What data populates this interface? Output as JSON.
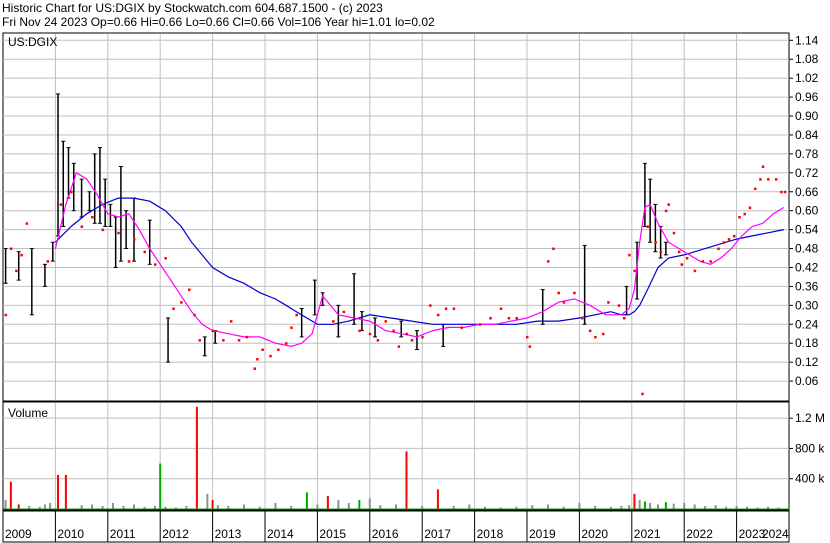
{
  "header": {
    "line1": "Historic Chart for US:DGIX by Stockwatch.com 604.687.1500 - (c) 2023",
    "line2": "Fri Nov 24 2023  Op=0.66  Hi=0.66  Lo=0.66  Cl=0.66  Vol=106  Year hi=1.01  lo=0.02"
  },
  "colors": {
    "grid": "#c0c0c0",
    "candle": "#000000",
    "dots": "#ff0000",
    "ma_short": "#ff00ff",
    "ma_long": "#0000cc",
    "vol_gray": "#909090",
    "vol_green": "#00aa00",
    "vol_red": "#ff0000"
  },
  "chart_data": [
    {
      "type": "line",
      "title": "US:DGIX",
      "ylim": [
        0.0,
        1.16
      ],
      "yticks": [
        "1.14",
        "1.08",
        "1.02",
        "0.96",
        "0.90",
        "0.84",
        "0.78",
        "0.72",
        "0.66",
        "0.60",
        "0.54",
        "0.48",
        "0.42",
        "0.36",
        "0.30",
        "0.24",
        "0.18",
        "0.12",
        "0.06"
      ],
      "xlim": [
        2009.0,
        2024.0
      ],
      "xticks": [
        "2009",
        "2010",
        "2011",
        "2012",
        "2013",
        "2014",
        "2015",
        "2016",
        "2017",
        "2018",
        "2019",
        "2020",
        "2021",
        "2022",
        "2023",
        "2024"
      ],
      "series": [
        {
          "key": "ma_long",
          "x": [
            2010.0,
            2010.3,
            2010.6,
            2010.9,
            2011.2,
            2011.5,
            2011.8,
            2012.1,
            2012.4,
            2012.6,
            2012.8,
            2013.0,
            2013.3,
            2013.6,
            2013.9,
            2014.2,
            2014.4,
            2014.6,
            2014.8,
            2015.0,
            2015.3,
            2015.6,
            2016.0,
            2016.4,
            2016.8,
            2017.2,
            2017.6,
            2018.0,
            2018.4,
            2018.8,
            2019.2,
            2019.6,
            2020.0,
            2020.3,
            2020.6,
            2020.8,
            2020.95,
            2021.05,
            2021.15,
            2021.3,
            2021.5,
            2021.7,
            2022.0,
            2022.4,
            2022.8,
            2023.0,
            2023.3,
            2023.6,
            2023.9
          ],
          "y": [
            0.5,
            0.55,
            0.59,
            0.62,
            0.64,
            0.64,
            0.63,
            0.6,
            0.55,
            0.5,
            0.46,
            0.42,
            0.39,
            0.37,
            0.34,
            0.32,
            0.3,
            0.28,
            0.26,
            0.24,
            0.24,
            0.25,
            0.27,
            0.26,
            0.25,
            0.24,
            0.24,
            0.24,
            0.24,
            0.24,
            0.25,
            0.25,
            0.26,
            0.27,
            0.28,
            0.27,
            0.27,
            0.28,
            0.3,
            0.35,
            0.42,
            0.45,
            0.46,
            0.48,
            0.5,
            0.51,
            0.52,
            0.53,
            0.54
          ]
        },
        {
          "key": "ma_short",
          "x": [
            2010.0,
            2010.2,
            2010.4,
            2010.6,
            2010.8,
            2011.0,
            2011.2,
            2011.4,
            2011.6,
            2011.8,
            2012.0,
            2012.2,
            2012.4,
            2012.6,
            2012.8,
            2013.0,
            2013.3,
            2013.6,
            2013.9,
            2014.2,
            2014.5,
            2014.7,
            2014.9,
            2015.1,
            2015.4,
            2015.7,
            2016.0,
            2016.3,
            2016.6,
            2016.9,
            2017.2,
            2017.5,
            2017.8,
            2018.1,
            2018.4,
            2018.7,
            2019.0,
            2019.3,
            2019.6,
            2019.9,
            2020.2,
            2020.5,
            2020.8,
            2020.95,
            2021.05,
            2021.15,
            2021.25,
            2021.35,
            2021.5,
            2021.7,
            2021.9,
            2022.1,
            2022.3,
            2022.5,
            2022.7,
            2022.9,
            2023.1,
            2023.3,
            2023.5,
            2023.7,
            2023.9
          ],
          "y": [
            0.48,
            0.62,
            0.72,
            0.7,
            0.65,
            0.59,
            0.58,
            0.59,
            0.54,
            0.48,
            0.43,
            0.38,
            0.33,
            0.28,
            0.24,
            0.22,
            0.21,
            0.2,
            0.2,
            0.18,
            0.17,
            0.18,
            0.21,
            0.33,
            0.27,
            0.26,
            0.25,
            0.22,
            0.21,
            0.2,
            0.22,
            0.23,
            0.23,
            0.24,
            0.24,
            0.25,
            0.26,
            0.28,
            0.31,
            0.32,
            0.3,
            0.27,
            0.27,
            0.29,
            0.35,
            0.5,
            0.61,
            0.62,
            0.56,
            0.5,
            0.48,
            0.46,
            0.44,
            0.43,
            0.45,
            0.48,
            0.52,
            0.55,
            0.56,
            0.59,
            0.61
          ]
        }
      ],
      "price_points": [
        {
          "x": 2009.05,
          "y": 0.27
        },
        {
          "x": 2009.15,
          "y": 0.48
        },
        {
          "x": 2009.25,
          "y": 0.41
        },
        {
          "x": 2009.35,
          "y": 0.46
        },
        {
          "x": 2009.45,
          "y": 0.56
        },
        {
          "x": 2009.85,
          "y": 0.44
        },
        {
          "x": 2010.1,
          "y": 0.62
        },
        {
          "x": 2010.3,
          "y": 0.66
        },
        {
          "x": 2010.5,
          "y": 0.55
        },
        {
          "x": 2010.7,
          "y": 0.58
        },
        {
          "x": 2010.9,
          "y": 0.54
        },
        {
          "x": 2011.2,
          "y": 0.53
        },
        {
          "x": 2011.4,
          "y": 0.44
        },
        {
          "x": 2011.5,
          "y": 0.51
        },
        {
          "x": 2011.7,
          "y": 0.47
        },
        {
          "x": 2011.9,
          "y": 0.43
        },
        {
          "x": 2012.1,
          "y": 0.45
        },
        {
          "x": 2012.25,
          "y": 0.29
        },
        {
          "x": 2012.4,
          "y": 0.31
        },
        {
          "x": 2012.55,
          "y": 0.35
        },
        {
          "x": 2012.65,
          "y": 0.27
        },
        {
          "x": 2012.75,
          "y": 0.19
        },
        {
          "x": 2013.0,
          "y": 0.22
        },
        {
          "x": 2013.2,
          "y": 0.19
        },
        {
          "x": 2013.35,
          "y": 0.25
        },
        {
          "x": 2013.5,
          "y": 0.19
        },
        {
          "x": 2013.65,
          "y": 0.2
        },
        {
          "x": 2013.8,
          "y": 0.1
        },
        {
          "x": 2013.85,
          "y": 0.13
        },
        {
          "x": 2013.95,
          "y": 0.16
        },
        {
          "x": 2014.1,
          "y": 0.14
        },
        {
          "x": 2014.25,
          "y": 0.16
        },
        {
          "x": 2014.4,
          "y": 0.18
        },
        {
          "x": 2014.5,
          "y": 0.23
        },
        {
          "x": 2014.6,
          "y": 0.27
        },
        {
          "x": 2015.3,
          "y": 0.25
        },
        {
          "x": 2015.5,
          "y": 0.28
        },
        {
          "x": 2015.8,
          "y": 0.22
        },
        {
          "x": 2016.0,
          "y": 0.21
        },
        {
          "x": 2016.15,
          "y": 0.19
        },
        {
          "x": 2016.3,
          "y": 0.25
        },
        {
          "x": 2016.45,
          "y": 0.22
        },
        {
          "x": 2016.55,
          "y": 0.17
        },
        {
          "x": 2016.7,
          "y": 0.21
        },
        {
          "x": 2016.8,
          "y": 0.19
        },
        {
          "x": 2017.0,
          "y": 0.2
        },
        {
          "x": 2017.15,
          "y": 0.3
        },
        {
          "x": 2017.3,
          "y": 0.27
        },
        {
          "x": 2017.45,
          "y": 0.29
        },
        {
          "x": 2017.6,
          "y": 0.29
        },
        {
          "x": 2017.75,
          "y": 0.23
        },
        {
          "x": 2018.1,
          "y": 0.24
        },
        {
          "x": 2018.3,
          "y": 0.26
        },
        {
          "x": 2018.5,
          "y": 0.29
        },
        {
          "x": 2018.65,
          "y": 0.26
        },
        {
          "x": 2018.8,
          "y": 0.26
        },
        {
          "x": 2019.0,
          "y": 0.2
        },
        {
          "x": 2019.05,
          "y": 0.17
        },
        {
          "x": 2019.4,
          "y": 0.44
        },
        {
          "x": 2019.5,
          "y": 0.48
        },
        {
          "x": 2019.6,
          "y": 0.34
        },
        {
          "x": 2019.7,
          "y": 0.31
        },
        {
          "x": 2019.9,
          "y": 0.34
        },
        {
          "x": 2020.05,
          "y": 0.26
        },
        {
          "x": 2020.2,
          "y": 0.22
        },
        {
          "x": 2020.3,
          "y": 0.2
        },
        {
          "x": 2020.45,
          "y": 0.21
        },
        {
          "x": 2020.55,
          "y": 0.31
        },
        {
          "x": 2020.75,
          "y": 0.3
        },
        {
          "x": 2020.85,
          "y": 0.26
        },
        {
          "x": 2020.95,
          "y": 0.46
        },
        {
          "x": 2021.05,
          "y": 0.41
        },
        {
          "x": 2021.2,
          "y": 0.02
        },
        {
          "x": 2021.3,
          "y": 0.55
        },
        {
          "x": 2021.45,
          "y": 0.5
        },
        {
          "x": 2021.55,
          "y": 0.47
        },
        {
          "x": 2021.65,
          "y": 0.6
        },
        {
          "x": 2021.7,
          "y": 0.62
        },
        {
          "x": 2021.8,
          "y": 0.53
        },
        {
          "x": 2021.9,
          "y": 0.47
        },
        {
          "x": 2021.95,
          "y": 0.43
        },
        {
          "x": 2022.05,
          "y": 0.45
        },
        {
          "x": 2022.2,
          "y": 0.41
        },
        {
          "x": 2022.35,
          "y": 0.44
        },
        {
          "x": 2022.5,
          "y": 0.44
        },
        {
          "x": 2022.65,
          "y": 0.48
        },
        {
          "x": 2022.75,
          "y": 0.5
        },
        {
          "x": 2022.85,
          "y": 0.51
        },
        {
          "x": 2022.95,
          "y": 0.52
        },
        {
          "x": 2023.05,
          "y": 0.58
        },
        {
          "x": 2023.15,
          "y": 0.59
        },
        {
          "x": 2023.25,
          "y": 0.61
        },
        {
          "x": 2023.35,
          "y": 0.67
        },
        {
          "x": 2023.45,
          "y": 0.7
        },
        {
          "x": 2023.5,
          "y": 0.74
        },
        {
          "x": 2023.6,
          "y": 0.7
        },
        {
          "x": 2023.75,
          "y": 0.7
        },
        {
          "x": 2023.85,
          "y": 0.66
        },
        {
          "x": 2023.92,
          "y": 0.66
        }
      ],
      "candles": [
        {
          "x": 2009.05,
          "lo": 0.37,
          "hi": 0.48
        },
        {
          "x": 2009.3,
          "lo": 0.38,
          "hi": 0.47
        },
        {
          "x": 2009.55,
          "lo": 0.27,
          "hi": 0.48
        },
        {
          "x": 2009.8,
          "lo": 0.36,
          "hi": 0.43
        },
        {
          "x": 2009.95,
          "lo": 0.44,
          "hi": 0.5
        },
        {
          "x": 2010.05,
          "lo": 0.52,
          "hi": 0.97
        },
        {
          "x": 2010.15,
          "lo": 0.55,
          "hi": 0.82
        },
        {
          "x": 2010.25,
          "lo": 0.64,
          "hi": 0.8
        },
        {
          "x": 2010.35,
          "lo": 0.6,
          "hi": 0.75
        },
        {
          "x": 2010.5,
          "lo": 0.58,
          "hi": 0.7
        },
        {
          "x": 2010.65,
          "lo": 0.6,
          "hi": 0.66
        },
        {
          "x": 2010.75,
          "lo": 0.56,
          "hi": 0.78
        },
        {
          "x": 2010.85,
          "lo": 0.56,
          "hi": 0.8
        },
        {
          "x": 2010.95,
          "lo": 0.55,
          "hi": 0.7
        },
        {
          "x": 2011.05,
          "lo": 0.55,
          "hi": 0.62
        },
        {
          "x": 2011.15,
          "lo": 0.42,
          "hi": 0.58
        },
        {
          "x": 2011.25,
          "lo": 0.44,
          "hi": 0.74
        },
        {
          "x": 2011.35,
          "lo": 0.48,
          "hi": 0.6
        },
        {
          "x": 2011.5,
          "lo": 0.44,
          "hi": 0.64
        },
        {
          "x": 2011.8,
          "lo": 0.43,
          "hi": 0.57
        },
        {
          "x": 2012.15,
          "lo": 0.12,
          "hi": 0.26
        },
        {
          "x": 2012.85,
          "lo": 0.14,
          "hi": 0.2
        },
        {
          "x": 2013.05,
          "lo": 0.18,
          "hi": 0.22
        },
        {
          "x": 2014.7,
          "lo": 0.2,
          "hi": 0.29
        },
        {
          "x": 2014.95,
          "lo": 0.27,
          "hi": 0.38
        },
        {
          "x": 2015.1,
          "lo": 0.3,
          "hi": 0.34
        },
        {
          "x": 2015.4,
          "lo": 0.2,
          "hi": 0.3
        },
        {
          "x": 2015.7,
          "lo": 0.24,
          "hi": 0.4
        },
        {
          "x": 2015.85,
          "lo": 0.22,
          "hi": 0.28
        },
        {
          "x": 2016.1,
          "lo": 0.2,
          "hi": 0.26
        },
        {
          "x": 2016.6,
          "lo": 0.2,
          "hi": 0.25
        },
        {
          "x": 2016.9,
          "lo": 0.16,
          "hi": 0.22
        },
        {
          "x": 2017.4,
          "lo": 0.17,
          "hi": 0.24
        },
        {
          "x": 2019.3,
          "lo": 0.24,
          "hi": 0.35
        },
        {
          "x": 2020.1,
          "lo": 0.24,
          "hi": 0.49
        },
        {
          "x": 2020.9,
          "lo": 0.27,
          "hi": 0.36
        },
        {
          "x": 2021.1,
          "lo": 0.32,
          "hi": 0.5
        },
        {
          "x": 2021.25,
          "lo": 0.55,
          "hi": 0.75
        },
        {
          "x": 2021.35,
          "lo": 0.5,
          "hi": 0.7
        },
        {
          "x": 2021.45,
          "lo": 0.47,
          "hi": 0.62
        },
        {
          "x": 2021.55,
          "lo": 0.45,
          "hi": 0.55
        },
        {
          "x": 2021.65,
          "lo": 0.46,
          "hi": 0.5
        }
      ]
    },
    {
      "type": "bar",
      "title": "Volume",
      "ylim": [
        0,
        1400000
      ],
      "yticks": [
        {
          "label": "1.2 M",
          "v": 1200000
        },
        {
          "label": "800 k",
          "v": 800000
        },
        {
          "label": "400 k",
          "v": 400000
        }
      ],
      "x": [
        2009.05,
        2009.15,
        2009.3,
        2009.5,
        2009.7,
        2009.8,
        2009.9,
        2010.05,
        2010.2,
        2010.5,
        2010.7,
        2010.9,
        2011.1,
        2011.3,
        2011.5,
        2011.7,
        2011.9,
        2012.0,
        2012.1,
        2012.3,
        2012.5,
        2012.7,
        2012.9,
        2013.0,
        2013.1,
        2013.3,
        2013.6,
        2013.9,
        2014.2,
        2014.5,
        2014.8,
        2015.0,
        2015.2,
        2015.4,
        2015.6,
        2015.8,
        2016.0,
        2016.2,
        2016.5,
        2016.7,
        2017.0,
        2017.3,
        2017.6,
        2017.9,
        2018.2,
        2018.5,
        2018.8,
        2019.1,
        2019.4,
        2019.7,
        2020.0,
        2020.3,
        2020.6,
        2020.8,
        2020.95,
        2021.05,
        2021.15,
        2021.25,
        2021.35,
        2021.5,
        2021.65,
        2021.8,
        2022.0,
        2022.2,
        2022.4,
        2022.6,
        2022.8,
        2023.0,
        2023.2,
        2023.4,
        2023.6,
        2023.8
      ],
      "values": [
        120000,
        360000,
        60000,
        40000,
        30000,
        60000,
        80000,
        450000,
        450000,
        50000,
        60000,
        40000,
        80000,
        40000,
        60000,
        30000,
        40000,
        600000,
        30000,
        20000,
        40000,
        1350000,
        200000,
        120000,
        50000,
        40000,
        60000,
        30000,
        80000,
        40000,
        220000,
        60000,
        170000,
        120000,
        80000,
        120000,
        140000,
        50000,
        60000,
        760000,
        40000,
        260000,
        40000,
        60000,
        30000,
        20000,
        30000,
        50000,
        60000,
        30000,
        80000,
        40000,
        30000,
        40000,
        50000,
        200000,
        120000,
        100000,
        80000,
        60000,
        90000,
        70000,
        80000,
        60000,
        40000,
        50000,
        30000,
        40000,
        30000,
        20000,
        30000,
        20000
      ],
      "colors": [
        "gray",
        "red",
        "red",
        "gray",
        "gray",
        "gray",
        "gray",
        "red",
        "red",
        "gray",
        "gray",
        "gray",
        "gray",
        "gray",
        "gray",
        "gray",
        "gray",
        "green",
        "gray",
        "gray",
        "gray",
        "red",
        "gray",
        "red",
        "gray",
        "gray",
        "gray",
        "gray",
        "gray",
        "gray",
        "green",
        "gray",
        "red",
        "gray",
        "gray",
        "green",
        "gray",
        "gray",
        "gray",
        "red",
        "gray",
        "red",
        "gray",
        "gray",
        "gray",
        "gray",
        "gray",
        "gray",
        "gray",
        "gray",
        "gray",
        "gray",
        "gray",
        "gray",
        "gray",
        "red",
        "gray",
        "green",
        "gray",
        "gray",
        "green",
        "gray",
        "gray",
        "gray",
        "gray",
        "gray",
        "gray",
        "gray",
        "gray",
        "gray",
        "gray",
        "gray"
      ]
    }
  ]
}
